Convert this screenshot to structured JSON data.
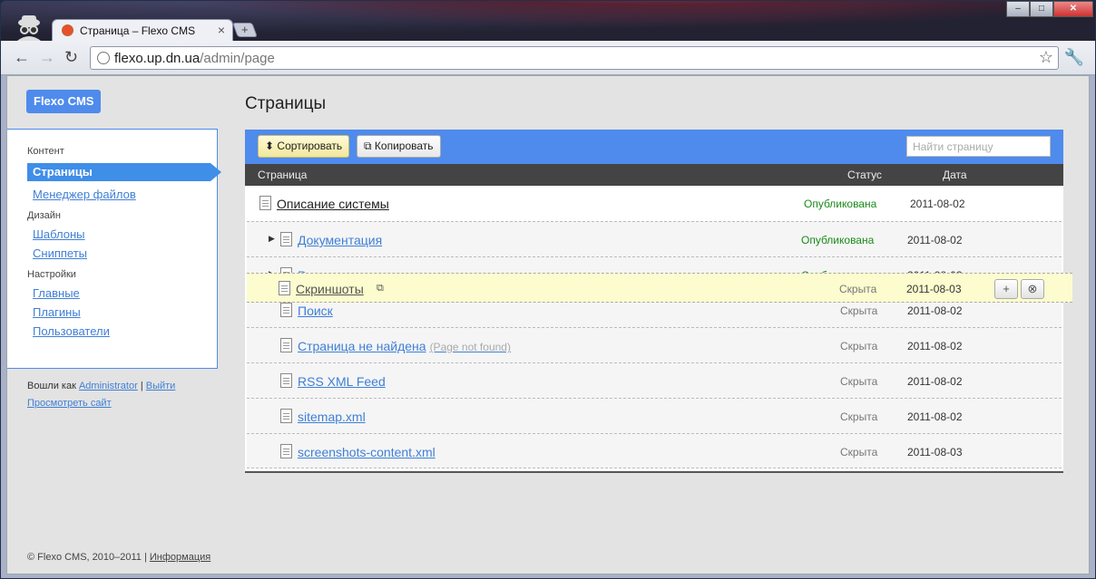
{
  "browser": {
    "tab_title": "Страница – Flexo CMS",
    "tab_close": "×",
    "new_tab": "+",
    "url_host": "flexo.up.dn.ua",
    "url_path": "/admin/page",
    "win_min": "–",
    "win_max": "□",
    "win_close": "✕"
  },
  "logo": "Flexo CMS",
  "sidebar": {
    "content_title": "Контент",
    "pages": "Страницы",
    "file_manager": "Менеджер файлов",
    "design_title": "Дизайн",
    "templates": "Шаблоны",
    "snippets": "Сниппеты",
    "settings_title": "Настройки",
    "main": "Главные",
    "plugins": "Плагины",
    "users": "Пользователи"
  },
  "session": {
    "logged_as": "Вошли как",
    "user": "Administrator",
    "sep": "|",
    "logout": "Выйти",
    "view_site": "Просмотреть сайт"
  },
  "footer": {
    "copyright": "© Flexo CMS, 2010–2011 |",
    "info": "Информация"
  },
  "heading": "Страницы",
  "actions": {
    "sort": "Сортировать",
    "copy": "Копировать",
    "search_placeholder": "Найти страницу"
  },
  "table": {
    "col_page": "Страница",
    "col_status": "Статус",
    "col_date": "Дата",
    "rows": [
      {
        "name": "Описание системы",
        "status": "Опубликована",
        "date": "2011-08-02"
      },
      {
        "name": "Документация",
        "status": "Опубликована",
        "date": "2011-08-02"
      },
      {
        "name": "Расширения",
        "status": "Опубликована",
        "date": "2011-08-02"
      },
      {
        "name": "Поиск",
        "status": "Скрыта",
        "date": "2011-08-02"
      },
      {
        "name": "Страница не найдена",
        "note": "(Page not found)",
        "status": "Скрыта",
        "date": "2011-08-02"
      },
      {
        "name": "RSS XML Feed",
        "status": "Скрыта",
        "date": "2011-08-02"
      },
      {
        "name": "sitemap.xml",
        "status": "Скрыта",
        "date": "2011-08-02"
      },
      {
        "name": "screenshots-content.xml",
        "status": "Скрыта",
        "date": "2011-08-03"
      }
    ],
    "dragging": {
      "name": "Скриншоты",
      "status": "Скрыта",
      "date": "2011-08-03",
      "add": "+",
      "remove": "⊗"
    }
  }
}
